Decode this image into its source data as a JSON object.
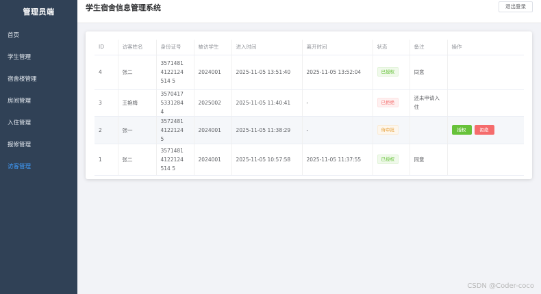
{
  "sidebar": {
    "title": "管理员端",
    "items": [
      {
        "label": "首页"
      },
      {
        "label": "学生管理"
      },
      {
        "label": "宿舍楼管理"
      },
      {
        "label": "房间管理"
      },
      {
        "label": "入住管理"
      },
      {
        "label": "报修管理"
      },
      {
        "label": "访客管理"
      }
    ],
    "active_index": 6,
    "active_color": "#409eff"
  },
  "header": {
    "title": "学生宿舍信息管理系统",
    "logout_label": "退出登录"
  },
  "table": {
    "columns": [
      "ID",
      "访客姓名",
      "身份证号",
      "被访学生",
      "进入时间",
      "离开时间",
      "状态",
      "备注",
      "操作"
    ],
    "rows": [
      {
        "id": "4",
        "name": "张二",
        "idcard": "35714814122124514 5",
        "student": "2024001",
        "enter": "2025-11-05 13:51:40",
        "leave": "2025-11-05 13:52:04",
        "status": "已授权",
        "note": "同意"
      },
      {
        "id": "3",
        "name": "王艳梅",
        "idcard": "357041753312844",
        "student": "2025002",
        "enter": "2025-11-05 11:40:41",
        "leave": "-",
        "status": "已拒绝",
        "note": "还未申请入住"
      },
      {
        "id": "2",
        "name": "张一",
        "idcard": "357248141221245",
        "student": "2024001",
        "enter": "2025-11-05 11:38:29",
        "leave": "-",
        "status": "待审批",
        "note": ""
      },
      {
        "id": "1",
        "name": "张二",
        "idcard": "35714814122124514 5",
        "student": "2024001",
        "enter": "2025-11-05 10:57:58",
        "leave": "2025-11-05 11:37:55",
        "status": "已授权",
        "note": "同意"
      }
    ],
    "actions": {
      "approve_label": "授权",
      "reject_label": "拒绝"
    }
  },
  "watermark": "CSDN @Coder-coco"
}
